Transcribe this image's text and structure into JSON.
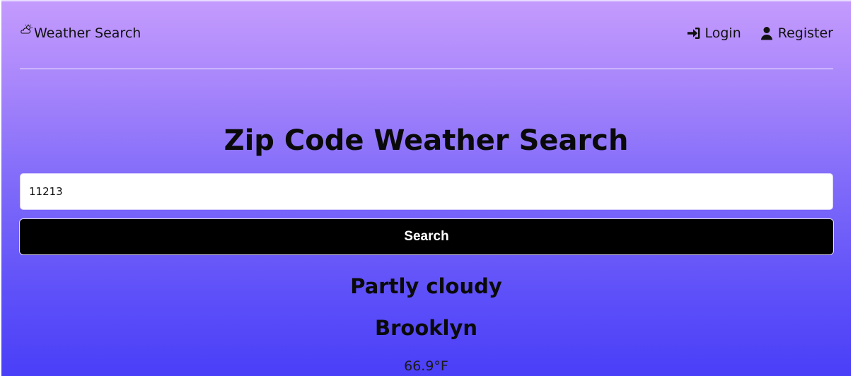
{
  "navbar": {
    "brand_label": "Weather Search",
    "brand_icon": "cloud-sun-icon",
    "login_label": "Login",
    "login_icon": "sign-in-icon",
    "register_label": "Register",
    "register_icon": "user-icon"
  },
  "main": {
    "title": "Zip Code Weather Search",
    "zip_value": "11213",
    "search_label": "Search"
  },
  "result": {
    "condition": "Partly cloudy",
    "city": "Brooklyn",
    "temperature": "66.9°F"
  },
  "colors": {
    "gradient_top": "#c49bfd",
    "gradient_bottom": "#4a3ff8",
    "button_bg": "#000000",
    "button_text": "#ffffff"
  }
}
